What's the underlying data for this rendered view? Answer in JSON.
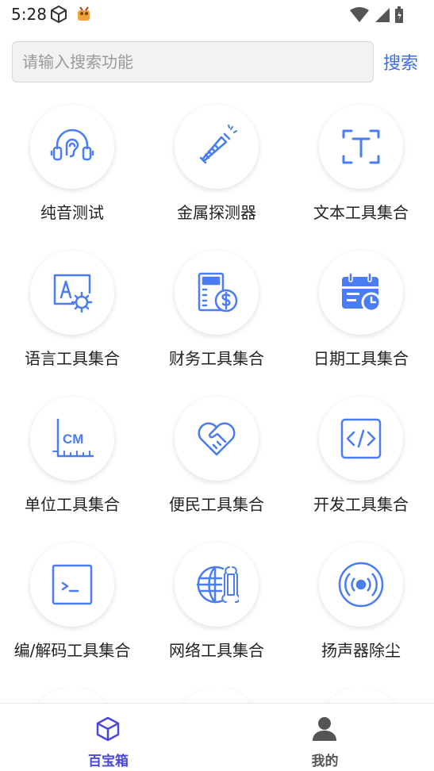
{
  "status_bar": {
    "time": "5:28"
  },
  "search": {
    "placeholder": "请输入搜索功能",
    "value": "",
    "button_label": "搜索"
  },
  "tools": [
    {
      "label": "纯音测试",
      "icon": "headphones-ear-icon"
    },
    {
      "label": "金属探测器",
      "icon": "metal-detector-icon"
    },
    {
      "label": "文本工具集合",
      "icon": "text-scan-icon"
    },
    {
      "label": "语言工具集合",
      "icon": "language-settings-icon"
    },
    {
      "label": "财务工具集合",
      "icon": "finance-calculator-icon"
    },
    {
      "label": "日期工具集合",
      "icon": "calendar-clock-icon"
    },
    {
      "label": "单位工具集合",
      "icon": "unit-ruler-icon"
    },
    {
      "label": "便民工具集合",
      "icon": "heart-handshake-icon"
    },
    {
      "label": "开发工具集合",
      "icon": "code-icon"
    },
    {
      "label": "编/解码工具集合",
      "icon": "terminal-icon"
    },
    {
      "label": "网络工具集合",
      "icon": "globe-wrench-icon"
    },
    {
      "label": "扬声器除尘",
      "icon": "speaker-vibration-icon"
    }
  ],
  "tabbar": {
    "items": [
      {
        "label": "百宝箱",
        "icon": "cube-icon",
        "active": true
      },
      {
        "label": "我的",
        "icon": "person-icon",
        "active": false
      }
    ]
  },
  "colors": {
    "accent": "#3d6ee0",
    "active_tab": "#4b47d9",
    "inactive_tab": "#555555",
    "icon_blue": "#4a7cf2"
  }
}
